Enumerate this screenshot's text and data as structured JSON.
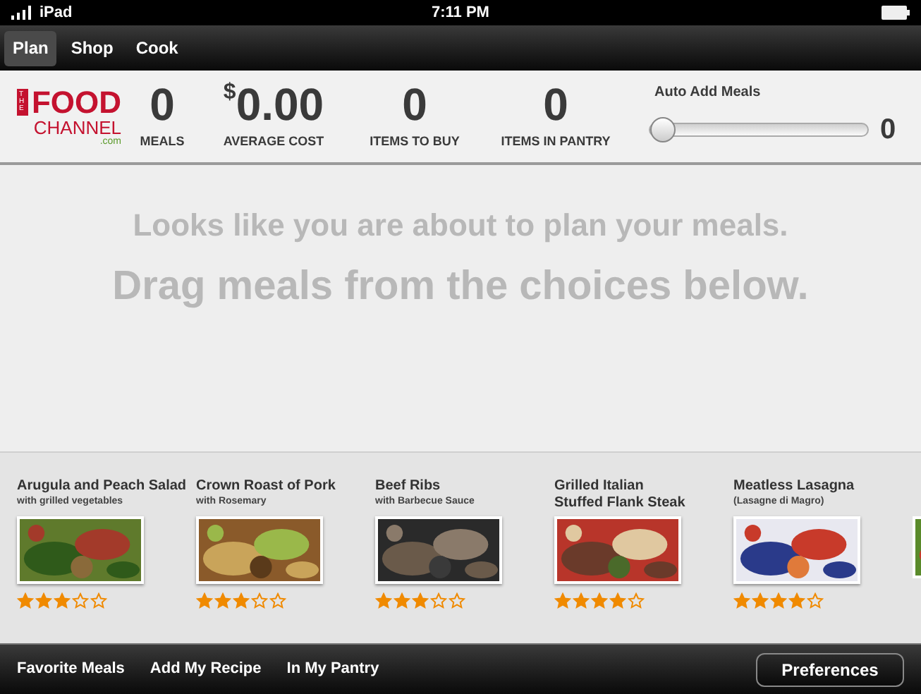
{
  "status_bar": {
    "carrier": "iPad",
    "time": "7:11 PM"
  },
  "tabs": [
    {
      "label": "Plan",
      "selected": true
    },
    {
      "label": "Shop",
      "selected": false
    },
    {
      "label": "Cook",
      "selected": false
    }
  ],
  "logo": {
    "the": "THE",
    "food": "FOOD",
    "channel": "CHANNEL",
    "domain": ".com"
  },
  "stats": [
    {
      "value": "0",
      "label": "MEALS",
      "kind": "count"
    },
    {
      "value": "0.00",
      "currency": "$",
      "label": "AVERAGE COST",
      "kind": "money"
    },
    {
      "value": "0",
      "label": "ITEMS TO BUY",
      "kind": "count"
    },
    {
      "value": "0",
      "label": "ITEMS IN PANTRY",
      "kind": "count"
    }
  ],
  "auto_add": {
    "label": "Auto Add Meals",
    "level": 0,
    "reading": "0"
  },
  "message": {
    "line_1": "Looks like you are about to plan your meals.",
    "line_2": "Drag meals from the choices below."
  },
  "meals": [
    {
      "kind": "card",
      "title_lines": [
        "Arugula and Peach Salad"
      ],
      "subtitle": "with grilled vegetables",
      "stars": 3
    },
    {
      "kind": "card",
      "title_lines": [
        "Crown Roast of Pork"
      ],
      "subtitle": "with Rosemary",
      "stars": 3
    },
    {
      "kind": "card",
      "title_lines": [
        "Beef Ribs"
      ],
      "subtitle": "with Barbecue Sauce",
      "stars": 3
    },
    {
      "kind": "card",
      "title_lines": [
        "Grilled Italian",
        "Stuffed Flank Steak"
      ],
      "stars": 4
    },
    {
      "kind": "card",
      "title_lines": [
        "Meatless Lasagna"
      ],
      "subtitle": "(Lasagne di Magro)",
      "stars": 4
    },
    {
      "kind": "partial"
    }
  ],
  "bottom_links": [
    "Favorite Meals",
    "Add My Recipe",
    "In My Pantry"
  ],
  "preferences_button": "Preferences"
}
